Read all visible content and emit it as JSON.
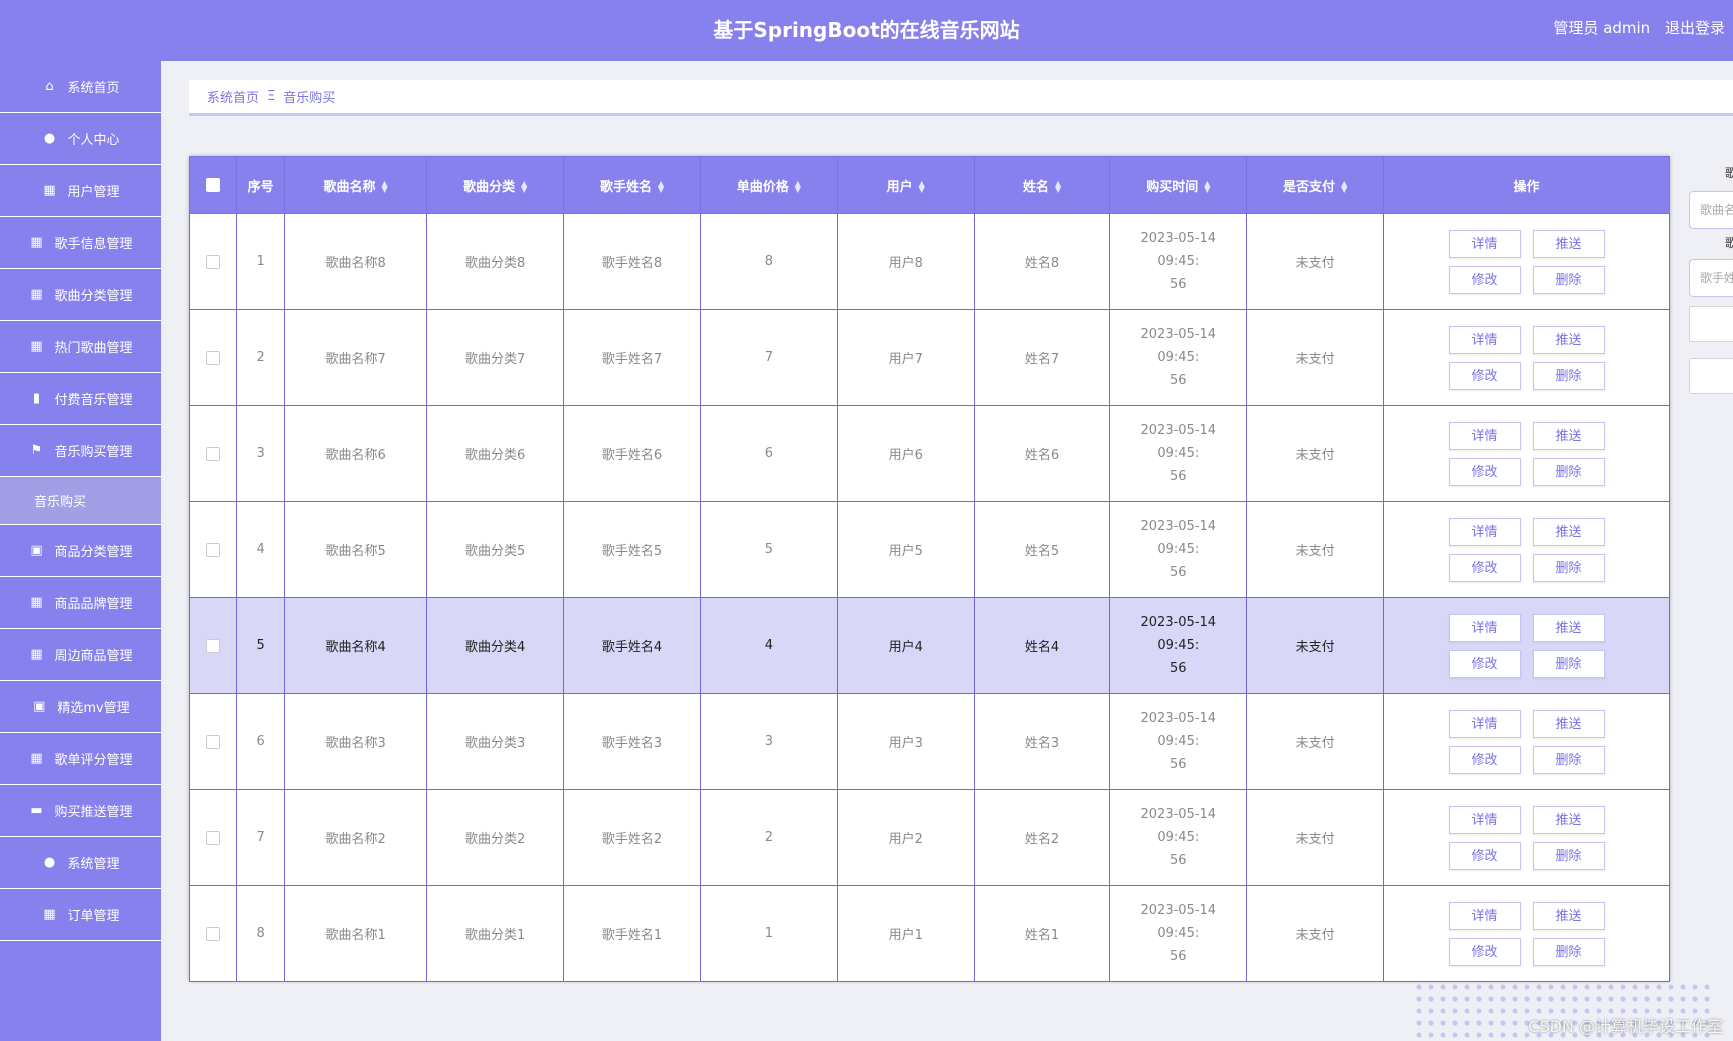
{
  "header": {
    "title": "基于SpringBoot的在线音乐网站",
    "user_label": "管理员 admin",
    "logout_label": "退出登录"
  },
  "sidebar": {
    "items": [
      {
        "label": "系统首页",
        "icon": "home-icon"
      },
      {
        "label": "个人中心",
        "icon": "user-icon"
      },
      {
        "label": "用户管理",
        "icon": "grid-icon"
      },
      {
        "label": "歌手信息管理",
        "icon": "grid-icon"
      },
      {
        "label": "歌曲分类管理",
        "icon": "grid-icon"
      },
      {
        "label": "热门歌曲管理",
        "icon": "grid-icon"
      },
      {
        "label": "付费音乐管理",
        "icon": "book-icon"
      },
      {
        "label": "音乐购买管理",
        "icon": "flag-icon"
      },
      {
        "label": "音乐购买",
        "icon": ""
      },
      {
        "label": "商品分类管理",
        "icon": "clipboard-icon"
      },
      {
        "label": "商品品牌管理",
        "icon": "grid-icon"
      },
      {
        "label": "周边商品管理",
        "icon": "grid-icon"
      },
      {
        "label": "精选mv管理",
        "icon": "clipboard-icon"
      },
      {
        "label": "歌单评分管理",
        "icon": "grid-icon"
      },
      {
        "label": "购买推送管理",
        "icon": "briefcase-icon"
      },
      {
        "label": "系统管理",
        "icon": "user-icon"
      },
      {
        "label": "订单管理",
        "icon": "grid-icon"
      }
    ]
  },
  "breadcrumb": {
    "home": "系统首页",
    "separator": "Ξ",
    "current": "音乐购买"
  },
  "table": {
    "columns": [
      "序号",
      "歌曲名称",
      "歌曲分类",
      "歌手姓名",
      "单曲价格",
      "用户",
      "姓名",
      "购买时间",
      "是否支付",
      "操作"
    ],
    "buttons": {
      "detail": "详情",
      "push": "推送",
      "edit": "修改",
      "delete": "删除"
    },
    "rows": [
      {
        "idx": "1",
        "song": "歌曲名称8",
        "category": "歌曲分类8",
        "singer": "歌手姓名8",
        "price": "8",
        "user": "用户8",
        "name": "姓名8",
        "time1": "2023-05-14 09:45:",
        "time2": "56",
        "paid": "未支付"
      },
      {
        "idx": "2",
        "song": "歌曲名称7",
        "category": "歌曲分类7",
        "singer": "歌手姓名7",
        "price": "7",
        "user": "用户7",
        "name": "姓名7",
        "time1": "2023-05-14 09:45:",
        "time2": "56",
        "paid": "未支付"
      },
      {
        "idx": "3",
        "song": "歌曲名称6",
        "category": "歌曲分类6",
        "singer": "歌手姓名6",
        "price": "6",
        "user": "用户6",
        "name": "姓名6",
        "time1": "2023-05-14 09:45:",
        "time2": "56",
        "paid": "未支付"
      },
      {
        "idx": "4",
        "song": "歌曲名称5",
        "category": "歌曲分类5",
        "singer": "歌手姓名5",
        "price": "5",
        "user": "用户5",
        "name": "姓名5",
        "time1": "2023-05-14 09:45:",
        "time2": "56",
        "paid": "未支付"
      },
      {
        "idx": "5",
        "song": "歌曲名称4",
        "category": "歌曲分类4",
        "singer": "歌手姓名4",
        "price": "4",
        "user": "用户4",
        "name": "姓名4",
        "time1": "2023-05-14 09:45:",
        "time2": "56",
        "paid": "未支付"
      },
      {
        "idx": "6",
        "song": "歌曲名称3",
        "category": "歌曲分类3",
        "singer": "歌手姓名3",
        "price": "3",
        "user": "用户3",
        "name": "姓名3",
        "time1": "2023-05-14 09:45:",
        "time2": "56",
        "paid": "未支付"
      },
      {
        "idx": "7",
        "song": "歌曲名称2",
        "category": "歌曲分类2",
        "singer": "歌手姓名2",
        "price": "2",
        "user": "用户2",
        "name": "姓名2",
        "time1": "2023-05-14 09:45:",
        "time2": "56",
        "paid": "未支付"
      },
      {
        "idx": "8",
        "song": "歌曲名称1",
        "category": "歌曲分类1",
        "singer": "歌手姓名1",
        "price": "1",
        "user": "用户1",
        "name": "姓名1",
        "time1": "2023-05-14 09:45:",
        "time2": "56",
        "paid": "未支付"
      }
    ]
  },
  "right_panel": {
    "label1": "歌",
    "placeholder1": "歌曲名",
    "label2": "歌",
    "placeholder2": "歌手姓"
  },
  "watermark": "CSDN @计算机毕设工作室",
  "colors": {
    "primary": "#8781ee",
    "selected_row": "#d9d7f8"
  }
}
